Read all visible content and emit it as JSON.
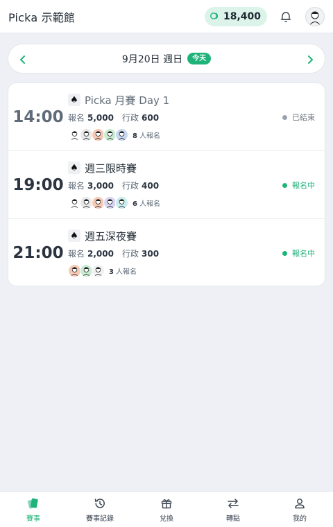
{
  "header": {
    "brand": "Picka 示範館",
    "points": "18,400",
    "points_icon": "coin-icon",
    "bell_icon": "bell-icon",
    "avatar_icon": "avatar-icon"
  },
  "date_bar": {
    "date_text": "9月20日 週日",
    "today_label": "今天",
    "prev_icon": "chevron-left-icon",
    "next_icon": "chevron-right-icon"
  },
  "colors": {
    "accent": "#1fb37a",
    "ended": "#9aa3ad",
    "text": "#1f2933"
  },
  "events": [
    {
      "time": "14:00",
      "title": "Picka 月賽 Day 1",
      "fee_label": "報名",
      "fee": "5,000",
      "admin_label": "行政",
      "admin": "600",
      "faces": [
        "#ffffff",
        "#e8e8e8",
        "#f6c9b6",
        "#c9ecd2",
        "#c9d8f0"
      ],
      "count": "8",
      "count_suffix": "人報名",
      "status": "已結束",
      "status_type": "ended"
    },
    {
      "time": "19:00",
      "title": "週三限時賽",
      "fee_label": "報名",
      "fee": "3,000",
      "admin_label": "行政",
      "admin": "400",
      "faces": [
        "#ffffff",
        "#e8e8e8",
        "#f6c9b6",
        "#d8d4f2",
        "#c9ecee"
      ],
      "count": "6",
      "count_suffix": "人報名",
      "status": "報名中",
      "status_type": "open"
    },
    {
      "time": "21:00",
      "title": "週五深夜賽",
      "fee_label": "報名",
      "fee": "2,000",
      "admin_label": "行政",
      "admin": "300",
      "faces": [
        "#f6c9b6",
        "#c9ecd2",
        "#f1f1f1"
      ],
      "count": "3",
      "count_suffix": "人報名",
      "status": "報名中",
      "status_type": "open"
    }
  ],
  "nav": [
    {
      "label": "賽事",
      "icon": "cards-icon",
      "active": true
    },
    {
      "label": "賽事記錄",
      "icon": "history-icon",
      "active": false
    },
    {
      "label": "兌換",
      "icon": "gift-icon",
      "active": false
    },
    {
      "label": "轉點",
      "icon": "transfer-icon",
      "active": false
    },
    {
      "label": "我的",
      "icon": "user-icon",
      "active": false
    }
  ]
}
